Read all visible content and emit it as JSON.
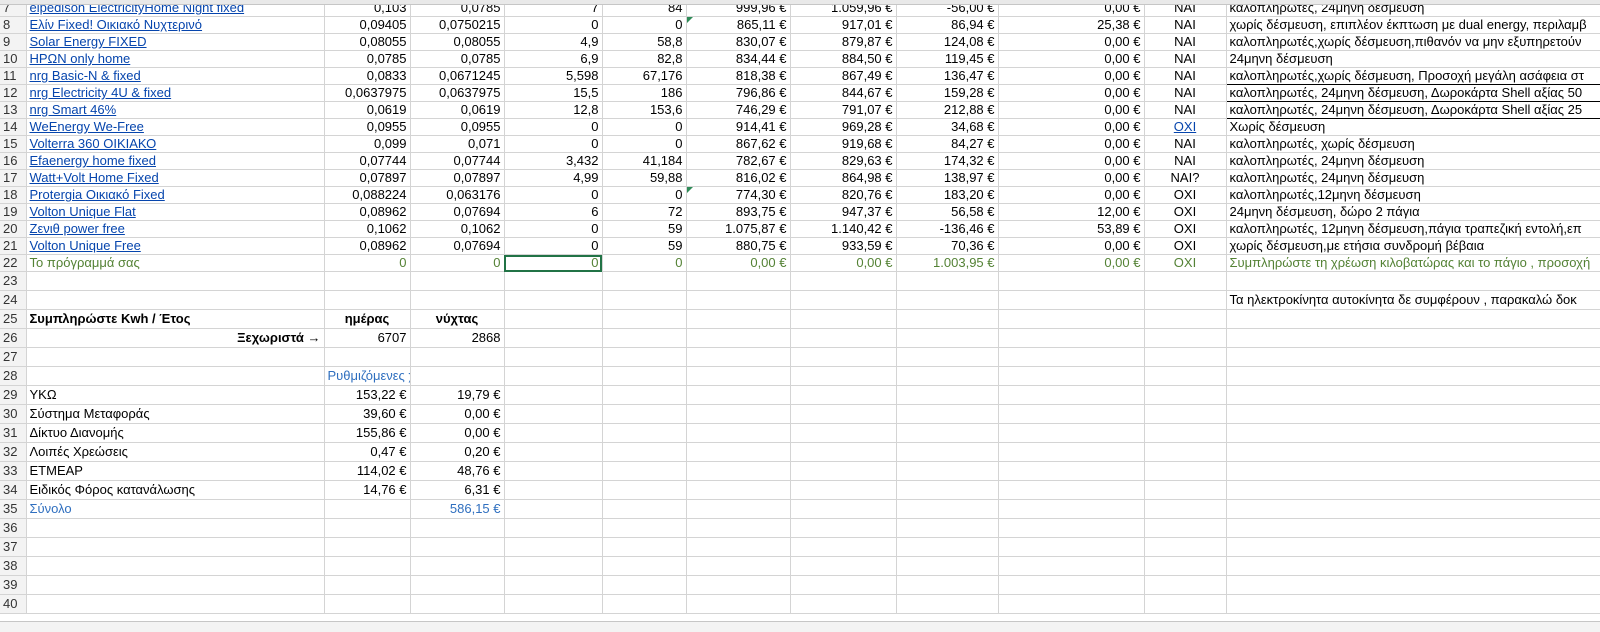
{
  "rows": [
    {
      "n": "7",
      "c": [
        "elpedison ElectricityHome Night fixed",
        "0,103",
        "0,0785",
        "7",
        "84",
        "999,96 €",
        "1.059,96 €",
        "-56,00 €",
        "0,00 €",
        "ΝΑΙ",
        "καλοπληρωτές, 24μηνη δέσμευση"
      ]
    },
    {
      "n": "8",
      "c": [
        "Ελίν Fixed! Οικιακό Νυχτερινό",
        "0,09405",
        "0,0750215",
        "0",
        "0",
        "865,11 €",
        "917,01 €",
        "86,94 €",
        "25,38 €",
        "ΝΑΙ",
        "χωρίς δέσμευση, επιπλέον έκπτωση με dual energy, περιλαμβ"
      ]
    },
    {
      "n": "9",
      "c": [
        "Solar Energy FIXED",
        "0,08055",
        "0,08055",
        "4,9",
        "58,8",
        "830,07 €",
        "879,87 €",
        "124,08 €",
        "0,00 €",
        "ΝΑΙ",
        "καλοπληρωτές,χωρίς δέσμευση,πιθανόν να μην εξυπηρετούν"
      ]
    },
    {
      "n": "10",
      "c": [
        "ΗΡΩΝ only home",
        "0,0785",
        "0,0785",
        "6,9",
        "82,8",
        "834,44 €",
        "884,50 €",
        "119,45 €",
        "0,00 €",
        "ΝΑΙ",
        "24μηνη δέσμευση"
      ]
    },
    {
      "n": "11",
      "c": [
        "nrg Basic-N & fixed",
        "0,0833",
        "0,0671245",
        "5,598",
        "67,176",
        "818,38 €",
        "867,49 €",
        "136,47 €",
        "0,00 €",
        "ΝΑΙ",
        "καλοπληρωτές,χωρίς δέσμευση, Προσοχή μεγάλη ασάφεια στ"
      ]
    },
    {
      "n": "12",
      "c": [
        "nrg Electricity 4U & fixed",
        "0,0637975",
        "0,0637975",
        "15,5",
        "186",
        "796,86 €",
        "844,67 €",
        "159,28 €",
        "0,00 €",
        "ΝΑΙ",
        "καλοπληρωτές, 24μηνη δέσμευση, Δωροκάρτα Shell αξίας 50"
      ]
    },
    {
      "n": "13",
      "c": [
        "nrg Smart 46%",
        "0,0619",
        "0,0619",
        "12,8",
        "153,6",
        "746,29 €",
        "791,07 €",
        "212,88 €",
        "0,00 €",
        "ΝΑΙ",
        "καλοπληρωτές, 24μηνη δέσμευση, Δωροκάρτα Shell αξίας 25"
      ]
    },
    {
      "n": "14",
      "c": [
        "WeEnergy We-Free",
        "0,0955",
        "0,0955",
        "0",
        "0",
        "914,41 €",
        "969,28 €",
        "34,68 €",
        "0,00 €",
        "ΟΧΙ",
        "Χωρίς δέσμευση"
      ]
    },
    {
      "n": "15",
      "c": [
        "Volterra 360 ΟΙΚΙΑΚΟ",
        "0,099",
        "0,071",
        "0",
        "0",
        "867,62 €",
        "919,68 €",
        "84,27 €",
        "0,00 €",
        "ΝΑΙ",
        "καλοπληρωτές, χωρίς δέσμευση"
      ]
    },
    {
      "n": "16",
      "c": [
        "Efaenergy home fixed",
        "0,07744",
        "0,07744",
        "3,432",
        "41,184",
        "782,67 €",
        "829,63 €",
        "174,32 €",
        "0,00 €",
        "ΝΑΙ",
        "καλοπληρωτές, 24μηνη δέσμευση"
      ]
    },
    {
      "n": "17",
      "c": [
        "Watt+Volt Home Fixed",
        "0,07897",
        "0,07897",
        "4,99",
        "59,88",
        "816,02 €",
        "864,98 €",
        "138,97 €",
        "0,00 €",
        "ΝΑΙ?",
        "καλοπληρωτές, 24μηνη δέσμευση"
      ]
    },
    {
      "n": "18",
      "c": [
        "Protergia Οικιακό Fixed",
        "0,088224",
        "0,063176",
        "0",
        "0",
        "774,30 €",
        "820,76 €",
        "183,20 €",
        "0,00 €",
        "ΟΧΙ",
        "καλοπληρωτές,12μηνη δέσμευση"
      ]
    },
    {
      "n": "19",
      "c": [
        "Volton Unique Flat",
        "0,08962",
        "0,07694",
        "6",
        "72",
        "893,75 €",
        "947,37 €",
        "56,58 €",
        "12,00 €",
        "ΟΧΙ",
        "24μηνη δέσμευση, δώρο 2 πάγια"
      ]
    },
    {
      "n": "20",
      "c": [
        "Ζενιθ power free",
        "0,1062",
        "0,1062",
        "0",
        "59",
        "1.075,87 €",
        "1.140,42 €",
        "-136,46 €",
        "53,89 €",
        "ΟΧΙ",
        "καλοπληρωτές, 12μηνη δέσμευση,πάγια τραπεζική εντολή,επ"
      ]
    },
    {
      "n": "21",
      "c": [
        "Volton Unique Free",
        "0,08962",
        "0,07694",
        "0",
        "59",
        "880,75 €",
        "933,59 €",
        "70,36 €",
        "0,00 €",
        "ΟΧΙ",
        "χωρίς δέσμευση,με ετήσια συνδρομή βέβαια"
      ]
    },
    {
      "n": "22",
      "c": [
        "Το πρόγραμμά σας",
        "0",
        "0",
        "0",
        "0",
        "0,00 €",
        "0,00 €",
        "1.003,95 €",
        "0,00 €",
        "ΟΧΙ",
        "Συμπληρώστε τη χρέωση κιλοβατώρας και το πάγιο , προσοχή"
      ]
    },
    {
      "n": "23",
      "c": [
        "",
        "",
        "",
        "",
        "",
        "",
        "",
        "",
        "",
        "",
        ""
      ]
    },
    {
      "n": "24",
      "c": [
        "",
        "",
        "",
        "",
        "",
        "",
        "",
        "",
        "",
        "",
        "Τα ηλεκτροκίνητα αυτοκίνητα δε συμφέρουν , παρακαλώ δοκ"
      ]
    },
    {
      "n": "25",
      "c": [
        "Συμπληρώστε Kwh / Έτος",
        "ημέρας",
        "νύχτας",
        "",
        "",
        "",
        "",
        "",
        "",
        "",
        ""
      ]
    },
    {
      "n": "26",
      "c": [
        "Ξεχωριστά →",
        "6707",
        "2868",
        "",
        "",
        "",
        "",
        "",
        "",
        "",
        ""
      ]
    },
    {
      "n": "27",
      "c": [
        "",
        "",
        "",
        "",
        "",
        "",
        "",
        "",
        "",
        "",
        ""
      ]
    },
    {
      "n": "28",
      "c": [
        "",
        "Ρυθμιζόμενες χρεώσεις",
        "",
        "",
        "",
        "",
        "",
        "",
        "",
        "",
        ""
      ]
    },
    {
      "n": "29",
      "c": [
        "ΥΚΩ",
        "153,22 €",
        "19,79 €",
        "",
        "",
        "",
        "",
        "",
        "",
        "",
        ""
      ]
    },
    {
      "n": "30",
      "c": [
        "Σύστημα Μεταφοράς",
        "39,60 €",
        "0,00 €",
        "",
        "",
        "",
        "",
        "",
        "",
        "",
        ""
      ]
    },
    {
      "n": "31",
      "c": [
        "Δίκτυο Διανομής",
        "155,86 €",
        "0,00 €",
        "",
        "",
        "",
        "",
        "",
        "",
        "",
        ""
      ]
    },
    {
      "n": "32",
      "c": [
        "Λοιπές Χρεώσεις",
        "0,47 €",
        "0,20 €",
        "",
        "",
        "",
        "",
        "",
        "",
        "",
        ""
      ]
    },
    {
      "n": "33",
      "c": [
        "ΕΤΜΕΑΡ",
        "114,02 €",
        "48,76 €",
        "",
        "",
        "",
        "",
        "",
        "",
        "",
        ""
      ]
    },
    {
      "n": "34",
      "c": [
        "Ειδικός Φόρος κατανάλωσης",
        "14,76 €",
        "6,31 €",
        "",
        "",
        "",
        "",
        "",
        "",
        "",
        ""
      ]
    },
    {
      "n": "35",
      "c": [
        "Σύνολο",
        "",
        "586,15 €",
        "",
        "",
        "",
        "",
        "",
        "",
        "",
        ""
      ]
    },
    {
      "n": "36",
      "c": [
        "",
        "",
        "",
        "",
        "",
        "",
        "",
        "",
        "",
        "",
        ""
      ]
    },
    {
      "n": "37",
      "c": [
        "",
        "",
        "",
        "",
        "",
        "",
        "",
        "",
        "",
        "",
        ""
      ]
    },
    {
      "n": "38",
      "c": [
        "",
        "",
        "",
        "",
        "",
        "",
        "",
        "",
        "",
        "",
        ""
      ]
    },
    {
      "n": "39",
      "c": [
        "",
        "",
        "",
        "",
        "",
        "",
        "",
        "",
        "",
        "",
        ""
      ]
    },
    {
      "n": "40",
      "c": [
        "",
        "",
        "",
        "",
        "",
        "",
        "",
        "",
        "",
        "",
        ""
      ]
    }
  ]
}
